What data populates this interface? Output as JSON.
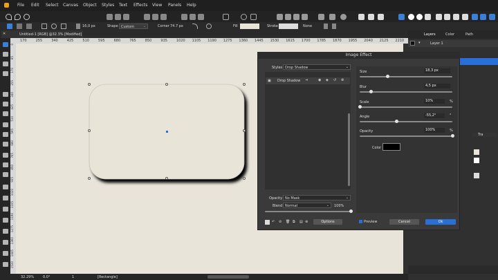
{
  "menu": [
    "File",
    "Edit",
    "Select",
    "Canvas",
    "Object",
    "Styles",
    "Text",
    "Effects",
    "View",
    "Panels",
    "Help"
  ],
  "toolbar2": {
    "size_value": "16,0 px",
    "shape_label": "Shape",
    "shape_value": "Custom",
    "corner_label": "Corner",
    "corner_value": "74.7 px",
    "fill_label": "Fill",
    "stroke_label": "Stroke",
    "stroke_value": "None"
  },
  "doc_tab": "Untitled-1 [RGB] @32.3% [Modified]",
  "ruler_ticks": [
    "170",
    "255",
    "340",
    "425",
    "510",
    "595",
    "680",
    "765",
    "850",
    "935",
    "1020",
    "1105",
    "1190",
    "1275",
    "1360",
    "1445",
    "1530",
    "1615",
    "1700",
    "1785",
    "1870",
    "1955",
    "2040",
    "2125",
    "2210"
  ],
  "ruler_left_ticks": [
    "0",
    "85",
    "170",
    "255",
    "340",
    "425",
    "510",
    "595",
    "680",
    "765",
    "850",
    "935",
    "1020",
    "1105",
    "1190",
    "1275",
    "1360",
    "1445",
    "1530"
  ],
  "status": {
    "zoom": "32.29%",
    "angle": "0.0°",
    "page": "1",
    "object": "[Rectangle]"
  },
  "panel": {
    "tabs": [
      "Layers",
      "Color",
      "Path"
    ],
    "layer_name": "Layer 1",
    "tra_label": "Tra"
  },
  "dialog": {
    "title": "Image Effect",
    "styles_label": "Styles",
    "styles_value": "Drop Shadow",
    "effect_item": "Drop Shadow",
    "size_label": "Size",
    "size_value": "18,3 px",
    "blur_label": "Blur",
    "blur_value": "4,5 px",
    "scale_label": "Scale",
    "scale_value": "10%",
    "scale_unit": "%",
    "angle_label": "Angle",
    "angle_value": "-55,2°",
    "angle_unit": "°",
    "opacity_label": "Opacity",
    "opacity_value": "100%",
    "opacity_unit": "%",
    "color_label": "Color",
    "bottom_opacity_label": "Opacity",
    "bottom_opacity_value": "No Mask",
    "blend_label": "Blend",
    "blend_value": "Normal",
    "blend_percent": "100%",
    "options_label": "Options",
    "preview_label": "Preview",
    "cancel_label": "Cancel",
    "ok_label": "Ok",
    "levels": {
      "size": 0.3,
      "blur": 0.12,
      "scale": 0.0,
      "angle": 0.4,
      "opacity": 1.0,
      "blend_opacity": 1.0
    }
  },
  "colors": {
    "accent": "#2a6fd6",
    "canvas": "#e8e4da",
    "shape_fill": "#e9e4d8",
    "shadow": "#111111",
    "fill_swatch": "#e8e4da",
    "stroke_swatch": "#dcdcdc"
  }
}
